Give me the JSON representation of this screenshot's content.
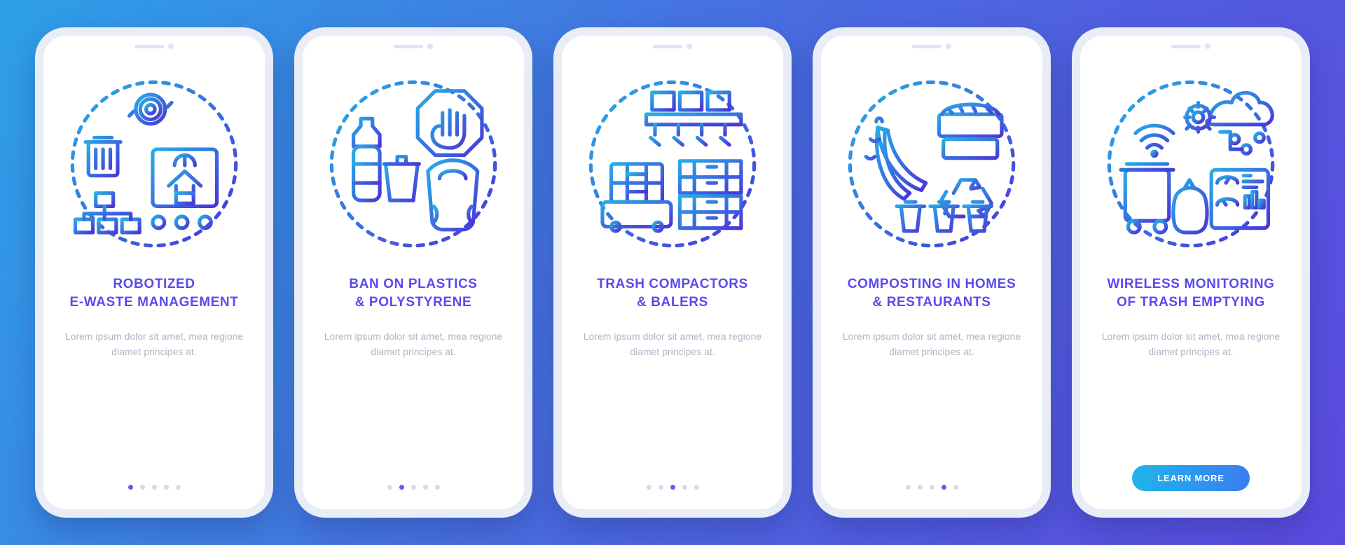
{
  "background_gradient": [
    "#2da0e8",
    "#4a6be0",
    "#5b4ae0"
  ],
  "stroke_gradient": [
    "#27aee6",
    "#4a35d9"
  ],
  "cta_label": "LEARN MORE",
  "body_text": "Lorem ipsum dolor sit amet, mea regione diamet principes at.",
  "screens": [
    {
      "title_line1": "ROBOTIZED",
      "title_line2": "E-WASTE MANAGEMENT",
      "icon": "robot-ewaste-icon",
      "active_dot": 0,
      "has_cta": false
    },
    {
      "title_line1": "BAN ON PLASTICS",
      "title_line2": "& POLYSTYRENE",
      "icon": "ban-plastics-icon",
      "active_dot": 1,
      "has_cta": false
    },
    {
      "title_line1": "TRASH COMPACTORS",
      "title_line2": "& BALERS",
      "icon": "compactors-icon",
      "active_dot": 2,
      "has_cta": false
    },
    {
      "title_line1": "COMPOSTING IN HOMES",
      "title_line2": "& RESTAURANTS",
      "icon": "composting-icon",
      "active_dot": 3,
      "has_cta": false
    },
    {
      "title_line1": "WIRELESS MONITORING",
      "title_line2": "OF TRASH EMPTYING",
      "icon": "wireless-monitoring-icon",
      "active_dot": 4,
      "has_cta": true
    }
  ]
}
